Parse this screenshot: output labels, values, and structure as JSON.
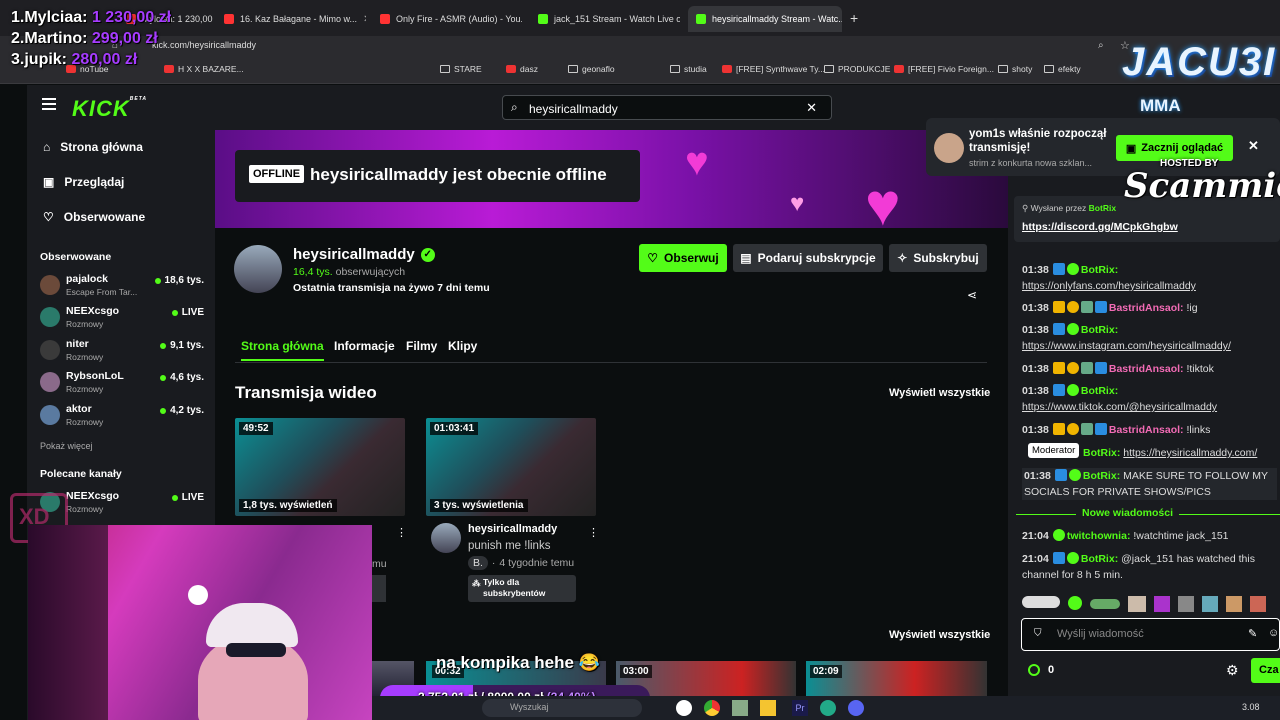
{
  "browser": {
    "tabs": [
      {
        "label": "Mylciaa: 1 230,00 zł",
        "active": false
      },
      {
        "label": "16. Kaz Bałagane - Mimo w...",
        "active": false
      },
      {
        "label": "Only Fire - ASMR (Audio) - You...",
        "active": false
      },
      {
        "label": "jack_151 Stream - Watch Live o...",
        "active": false
      },
      {
        "label": "heysiricallmaddy Stream - Watc...",
        "active": true
      }
    ],
    "url": "kick.com/heysiricallmaddy",
    "bookmarks": [
      "noTube",
      "H X X BAZARE...",
      "STARE",
      "dasz",
      "geonaflo",
      "studia",
      "[FREE] Synthwave Ty...",
      "PRODUKCJE",
      "[FREE] Fivio Foreign...",
      "shoty",
      "efekty"
    ]
  },
  "overlay": {
    "donors": [
      {
        "rank": "1.",
        "name": "Mylciaa:",
        "amount": "1 230,00 zł"
      },
      {
        "rank": "2.",
        "name": "Martino:",
        "amount": "299,00 zł"
      },
      {
        "rank": "3.",
        "name": "jupik:",
        "amount": "280,00 zł"
      }
    ],
    "caption": "na kompika hehe 😂",
    "goal_current": "2 752,01 zł",
    "goal_target": "8000,00 zł",
    "goal_pct": "(34.40%)",
    "goal_fraction": 0.344,
    "brand": "JACU3I",
    "brand_sub": "MMA",
    "hosted_by": "HOSTED BY",
    "hosted_name": "Scammiez",
    "xd": "XD"
  },
  "kick": {
    "logo": "KICK",
    "logo_sup": "BETA",
    "search_value": "heysiricallmaddy",
    "nav": [
      {
        "label": "Strona główna",
        "icon": "home-icon"
      },
      {
        "label": "Przeglądaj",
        "icon": "browse-icon"
      },
      {
        "label": "Obserwowane",
        "icon": "heart-icon"
      }
    ],
    "followed_title": "Obserwowane",
    "followed": [
      {
        "name": "pajalock",
        "category": "Escape From Tar...",
        "viewers": "18,6 tys.",
        "avatar": "#6b4a3a"
      },
      {
        "name": "NEEXcsgo",
        "category": "Rozmowy",
        "viewers": "LIVE",
        "avatar": "#2a7a6a"
      },
      {
        "name": "niter",
        "category": "Rozmowy",
        "viewers": "9,1 tys.",
        "avatar": "#3a3a3a"
      },
      {
        "name": "RybsonLoL",
        "category": "Rozmowy",
        "viewers": "4,6 tys.",
        "avatar": "#8a6a8a"
      },
      {
        "name": "aktor",
        "category": "Rozmowy",
        "viewers": "4,2 tys.",
        "avatar": "#5a7aa0"
      }
    ],
    "show_more": "Pokaż więcej",
    "recommended_title": "Polecane kanały",
    "recommended": [
      {
        "name": "NEEXcsgo",
        "category": "Rozmowy",
        "viewers": "LIVE"
      }
    ],
    "offline_badge": "OFFLINE",
    "offline_text": "heysiricallmaddy jest obecnie offline",
    "channel": {
      "name": "heysiricallmaddy",
      "followers": "16,4 tys.",
      "followers_label": "obserwujących",
      "last_stream": "Ostatnia transmisja na żywo 7 dni temu"
    },
    "actions": {
      "follow": "Obserwuj",
      "gift": "Podaruj subskrypcje",
      "subscribe": "Subskrybuj"
    },
    "tabs": [
      "Strona główna",
      "Informacje",
      "Filmy",
      "Klipy"
    ],
    "section_title": "Transmisja wideo",
    "view_all": "Wyświetl wszystkie",
    "videos": [
      {
        "duration": "49:52",
        "views": "1,8 tys. wyświetleń"
      },
      {
        "duration": "01:03:41",
        "views": "3 tys. wyświetlenia",
        "channel": "heysiricallmaddy",
        "title": "punish me !links",
        "badge": "B.",
        "ago": "4 tygodnie temu",
        "sub_only": "Tylko dla subskrybentów"
      }
    ],
    "clips_view_all": "Wyświetl wszystkie",
    "clips": [
      {
        "duration": "00:32"
      },
      {
        "duration": "03:00"
      },
      {
        "duration": "02:09"
      }
    ],
    "partial_ago": "mu"
  },
  "notification": {
    "user": "yom1s",
    "text": "właśnie rozpoczął transmisję!",
    "sub": "strim z konkurta nowa szklan...",
    "button": "Zacznij oglądać"
  },
  "chat": {
    "pinned_label": "Wysłane przez",
    "pinned_user": "BotRix",
    "pinned_link": "https://discord.gg/MCpkGhgbw",
    "messages": [
      {
        "time": "01:38",
        "user": "BotRix:",
        "color": "#53fc18",
        "text": "https://onlyfans.com/heysiricallmaddy"
      },
      {
        "time": "01:38",
        "user": "BastridAnsaol:",
        "color": "#f26bb5",
        "text": "!ig"
      },
      {
        "time": "01:38",
        "user": "BotRix:",
        "color": "#53fc18",
        "text": "https://www.instagram.com/heysiricallmaddy/"
      },
      {
        "time": "01:38",
        "user": "BastridAnsaol:",
        "color": "#f26bb5",
        "text": "!tiktok"
      },
      {
        "time": "01:38",
        "user": "BotRix:",
        "color": "#53fc18",
        "text": "https://www.tiktok.com/@heysiricallmaddy"
      },
      {
        "time": "01:38",
        "user": "BastridAnsaol:",
        "color": "#f26bb5",
        "text": "!links"
      },
      {
        "time": "01:38",
        "user": "BotRix:",
        "color": "#53fc18",
        "text": "https://heysiricallmaddy.com/"
      },
      {
        "time": "01:38",
        "user": "BotRix:",
        "color": "#53fc18",
        "text": "MAKE SURE TO FOLLOW MY SOCIALS FOR PRIVATE SHOWS/PICS"
      }
    ],
    "tooltip": "Moderator",
    "new_messages": "Nowe wiadomości",
    "new": [
      {
        "time": "21:04",
        "user": "twitchownia:",
        "color": "#53fc18",
        "text": "!watchtime jack_151"
      },
      {
        "time": "21:04",
        "user": "BotRix:",
        "color": "#53fc18",
        "text": "@jack_151 has watched this channel for 8 h 5 min."
      }
    ],
    "input_placeholder": "Wyślij wiadomość",
    "points": "0",
    "send": "Cza"
  },
  "taskbar": {
    "search": "Wyszukaj",
    "time": "3.08"
  }
}
